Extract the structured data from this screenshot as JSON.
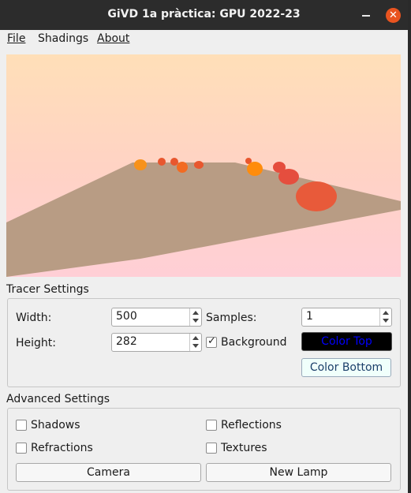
{
  "window": {
    "title": "GiVD 1a pràctica: GPU 2022-23"
  },
  "menu": {
    "file": "File",
    "shadings": "Shadings",
    "about": "About"
  },
  "scene": {
    "sky_top_color": "#ffdfb8",
    "sky_bottom_color": "#ffcfd6",
    "floor_color": "#b89c84",
    "sphere_colors": [
      "#f7921b",
      "#e8572e",
      "#e54e3e",
      "#ff8c0c"
    ]
  },
  "tracer": {
    "label": "Tracer Settings",
    "width_label": "Width:",
    "width_value": "500",
    "height_label": "Height:",
    "height_value": "282",
    "samples_label": "Samples:",
    "samples_value": "1",
    "background_label": "Background",
    "background_checked": true,
    "color_top_label": "Color Top",
    "color_bottom_label": "Color Bottom",
    "color_top_bg": "#000000",
    "color_top_text": "#0000ff",
    "color_bottom_bg": "#f0fffb"
  },
  "advanced": {
    "label": "Advanced Settings",
    "shadows_label": "Shadows",
    "reflections_label": "Reflections",
    "refractions_label": "Refractions",
    "textures_label": "Textures",
    "camera_label": "Camera",
    "new_lamp_label": "New Lamp"
  }
}
